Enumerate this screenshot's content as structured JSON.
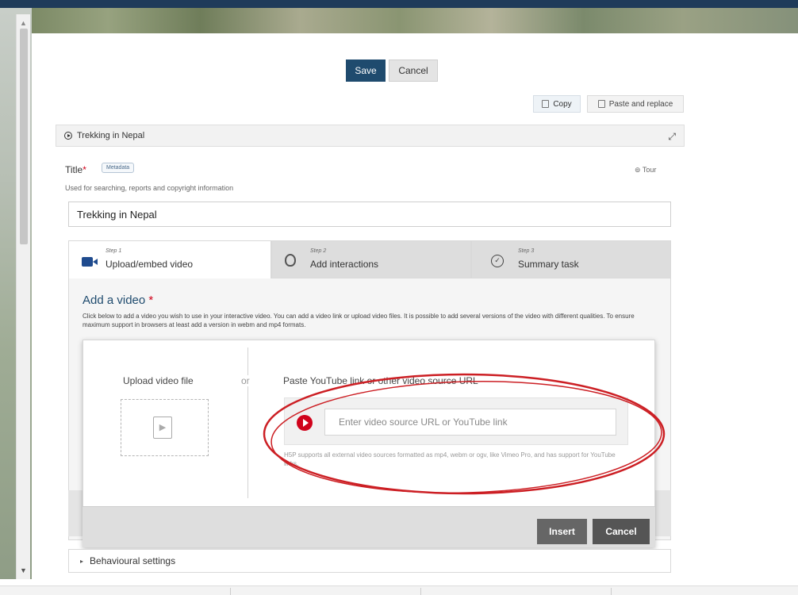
{
  "toolbar": {
    "save": "Save",
    "cancel": "Cancel",
    "copy": "Copy",
    "paste_replace": "Paste and replace"
  },
  "content": {
    "header_title": "Trekking in Nepal"
  },
  "title_field": {
    "label": "Title",
    "required_mark": "*",
    "metadata_tag": "Metadata",
    "tour": "⊚ Tour",
    "description": "Used for searching, reports and copyright information",
    "value": "Trekking in Nepal"
  },
  "tabs": [
    {
      "step": "Step 1",
      "label": "Upload/embed video"
    },
    {
      "step": "Step 2",
      "label": "Add interactions"
    },
    {
      "step": "Step 3",
      "label": "Summary task"
    }
  ],
  "add_video": {
    "title": "Add a video",
    "required_mark": "*",
    "description": "Click below to add a video you wish to use in your interactive video. You can add a video link or upload video files. It is possible to add several versions of the video with different qualities. To ensure maximum support in browsers at least add a version in webm and mp4 formats."
  },
  "dialog": {
    "upload_label": "Upload video file",
    "or_label": "or",
    "paste_label": "Paste YouTube link or other video source URL",
    "url_placeholder": "Enter video source URL or YouTube link",
    "url_note": "H5P supports all external video sources formatted as mp4, webm or ogv, like Vimeo Pro, and has support for YouTube links.",
    "insert": "Insert",
    "cancel": "Cancel"
  },
  "behavioural": {
    "label": "Behavioural settings"
  },
  "colors": {
    "primary": "#1f4b6e",
    "annotation": "#cc1f24",
    "youtube": "#d0021b"
  },
  "icons": [
    "video-camera-icon",
    "hand-pointer-icon",
    "check-circle-icon",
    "youtube-play-icon",
    "upload-file-icon",
    "copy-icon",
    "paste-icon",
    "expand-icon",
    "play-circle-icon"
  ]
}
